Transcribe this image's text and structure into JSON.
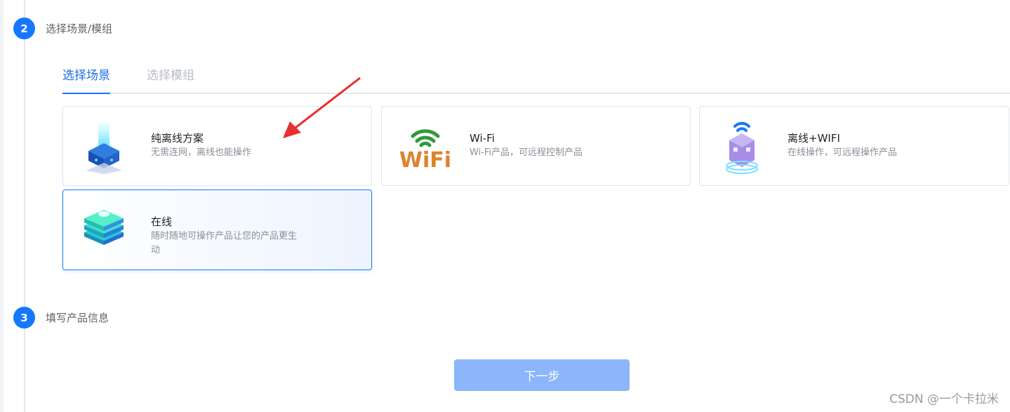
{
  "steps": [
    {
      "number": "2",
      "title": "选择场景/模组"
    },
    {
      "number": "3",
      "title": "填写产品信息"
    }
  ],
  "tabs": [
    {
      "label": "选择场景",
      "active": true
    },
    {
      "label": "选择模组",
      "active": false
    }
  ],
  "cards": [
    {
      "title": "纯离线方案",
      "desc": "无需连网，离线也能操作",
      "icon": "offline-cube-icon",
      "selected": false
    },
    {
      "title": "Wi-Fi",
      "desc": "Wi-Fi产品，可远程控制产品",
      "icon": "wifi-logo-icon",
      "icon_text": "WiFi",
      "selected": false
    },
    {
      "title": "离线+WIFI",
      "desc": "在线操作，可远程操作产品",
      "icon": "offline-wifi-building-icon",
      "selected": false
    },
    {
      "title": "在线",
      "desc": "随时随地可操作产品让您的产品更生动",
      "icon": "online-server-stack-icon",
      "selected": true
    }
  ],
  "next_button": {
    "label": "下一步",
    "disabled": true
  },
  "watermark": "CSDN @一个卡拉米",
  "colors": {
    "primary": "#1677ff",
    "disabled_button": "#8cb6fb",
    "annotation_arrow": "#e8312f"
  }
}
